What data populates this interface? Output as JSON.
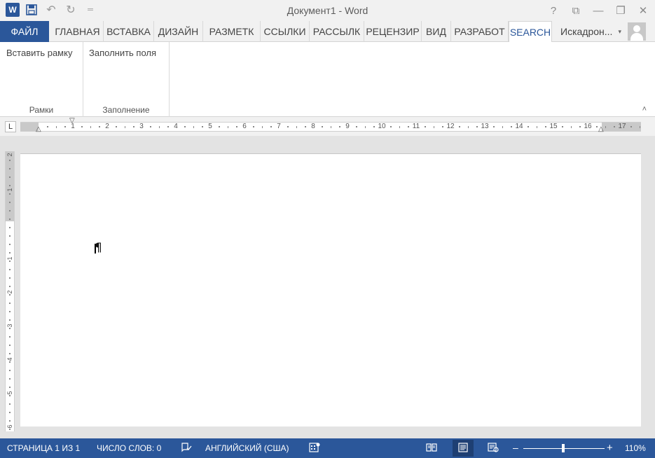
{
  "titlebar": {
    "title": "Документ1 - Word",
    "word_logo": "W",
    "icons": [
      "word-logo",
      "save-icon",
      "undo-icon",
      "redo-icon",
      "customize-qat-icon"
    ],
    "controls": [
      "?",
      "⧉",
      "—",
      "❐",
      "✕"
    ]
  },
  "tabs": {
    "file": "ФАЙЛ",
    "items": [
      "ГЛАВНАЯ",
      "ВСТАВКА",
      "ДИЗАЙН",
      "РАЗМЕТК",
      "ССЫЛКИ",
      "РАССЫЛК",
      "РЕЦЕНЗИР",
      "ВИД",
      "РАЗРАБОТ",
      "SEARCH"
    ],
    "active": "SEARCH",
    "account": "Искадрон...",
    "account_caret": "▾"
  },
  "ribbon": {
    "groups": [
      {
        "label": "Рамки",
        "button": "Вставить рамку"
      },
      {
        "label": "Заполнение",
        "button": "Заполнить поля"
      }
    ],
    "collapse_glyph": "˄"
  },
  "ruler": {
    "tab_selector": "L",
    "labels": [
      "1",
      "2",
      "3",
      "4",
      "5",
      "6",
      "7",
      "8",
      "9",
      "10",
      "11",
      "12",
      "13",
      "14",
      "15",
      "16",
      "17"
    ],
    "vertical_labels": [
      "2",
      "1",
      "1",
      "2",
      "3",
      "4",
      "5",
      "6"
    ]
  },
  "document": {
    "paragraph_mark": "¶"
  },
  "statusbar": {
    "page": "СТРАНИЦА 1 ИЗ 1",
    "words": "ЧИСЛО СЛОВ: 0",
    "language": "АНГЛИЙСКИЙ (США)",
    "zoom_minus": "–",
    "zoom_plus": "+",
    "zoom": "110%",
    "zoom_level": 1.1
  },
  "colors": {
    "accent": "#2b579a",
    "background": "#f1f1f1"
  }
}
